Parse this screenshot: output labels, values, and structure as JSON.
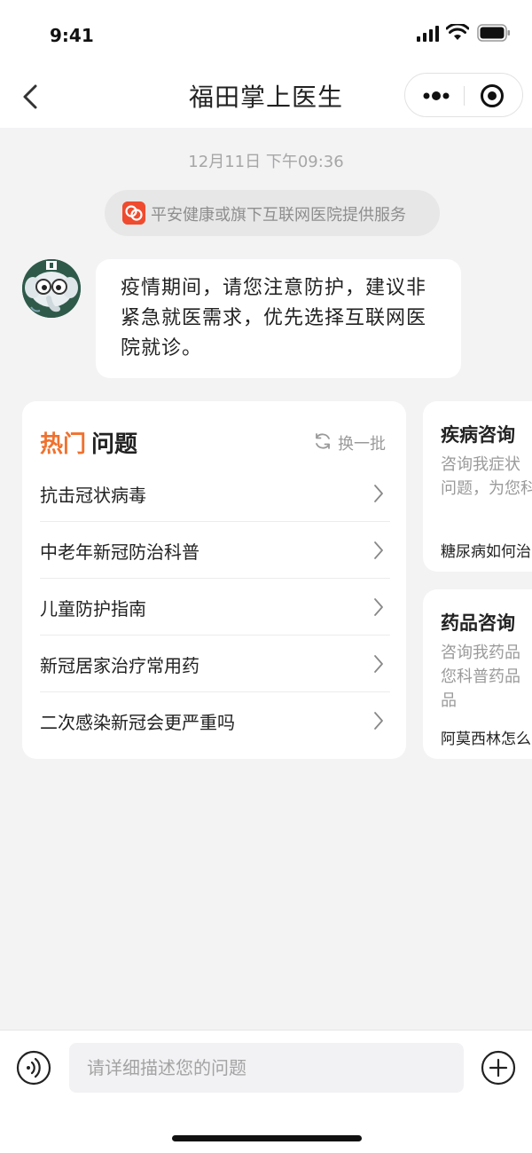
{
  "status_bar": {
    "time": "9:41"
  },
  "nav": {
    "title": "福田掌上医生"
  },
  "chat": {
    "timestamp": "12月11日 下午09:36",
    "service_notice": "平安健康或旗下互联网医院提供服务",
    "message": "疫情期间，请您注意防护，建议非紧急就医需求，优先选择互联网医院就诊。"
  },
  "hot_questions": {
    "title_accent": "热门",
    "title_rest": "问题",
    "refresh_label": "换一批",
    "items": [
      "抗击冠状病毒",
      "中老年新冠防治科普",
      "儿童防护指南",
      "新冠居家治疗常用药",
      "二次感染新冠会更严重吗"
    ]
  },
  "side_cards": [
    {
      "title": "疾病咨询",
      "desc": "咨询我症状\n问题，为您科",
      "example": "糖尿病如何治"
    },
    {
      "title": "药品咨询",
      "desc": "咨询我药品\n您科普药品\n品",
      "example": "阿莫西林怎么"
    }
  ],
  "input": {
    "placeholder": "请详细描述您的问题"
  },
  "colors": {
    "accent": "#f0712e",
    "brand_red": "#ef4b2f",
    "background": "#f3f3f4"
  },
  "icons": [
    "signal-icon",
    "wifi-icon",
    "battery-icon",
    "back-icon",
    "more-icon",
    "close-target-icon",
    "refresh-icon",
    "chevron-right-icon",
    "voice-icon",
    "add-icon"
  ]
}
